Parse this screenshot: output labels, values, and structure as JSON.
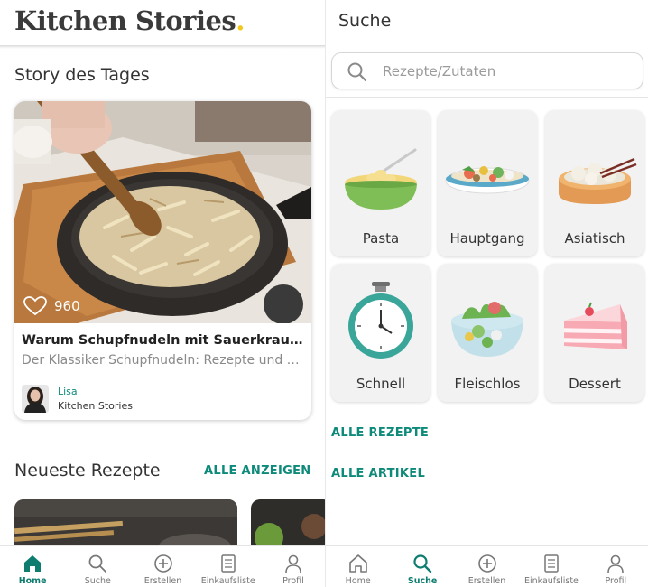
{
  "left": {
    "brand": "Kitchen Stories",
    "brand_dot": ".",
    "story_title": "Story des Tages",
    "story": {
      "likes": "960",
      "headline": "Warum Schupfnudeln mit Sauerkraut so be...",
      "subtitle": "Der Klassiker Schupfnudeln: Rezepte und Ti...",
      "author_name": "Lisa",
      "author_org": "Kitchen Stories"
    },
    "newest_title": "Neueste Rezepte",
    "see_all": "ALLE ANZEIGEN",
    "tabs": [
      {
        "label": "Home",
        "icon": "home-icon",
        "active": true
      },
      {
        "label": "Suche",
        "icon": "search-icon",
        "active": false
      },
      {
        "label": "Erstellen",
        "icon": "plus-circle-icon",
        "active": false
      },
      {
        "label": "Einkaufsliste",
        "icon": "shopping-list-icon",
        "active": false
      },
      {
        "label": "Profil",
        "icon": "profile-icon",
        "active": false
      }
    ]
  },
  "right": {
    "title": "Suche",
    "search_placeholder": "Rezepte/Zutaten",
    "categories": [
      {
        "label": "Pasta",
        "icon": "pasta-bowl-icon"
      },
      {
        "label": "Hauptgang",
        "icon": "main-course-plate-icon"
      },
      {
        "label": "Asiatisch",
        "icon": "dim-sum-basket-icon"
      },
      {
        "label": "Schnell",
        "icon": "stopwatch-icon"
      },
      {
        "label": "Fleischlos",
        "icon": "salad-bowl-icon"
      },
      {
        "label": "Dessert",
        "icon": "cake-slice-icon"
      }
    ],
    "all_recipes": "ALLE REZEPTE",
    "all_articles": "ALLE ARTIKEL",
    "tabs": [
      {
        "label": "Home",
        "icon": "home-icon",
        "active": false
      },
      {
        "label": "Suche",
        "icon": "search-icon",
        "active": true
      },
      {
        "label": "Erstellen",
        "icon": "plus-circle-icon",
        "active": false
      },
      {
        "label": "Einkaufsliste",
        "icon": "shopping-list-icon",
        "active": false
      },
      {
        "label": "Profil",
        "icon": "profile-icon",
        "active": false
      }
    ]
  },
  "colors": {
    "accent": "#0e8a7a",
    "brand_dot": "#f2c81a",
    "text": "#333333",
    "muted": "#8a8a8a"
  }
}
